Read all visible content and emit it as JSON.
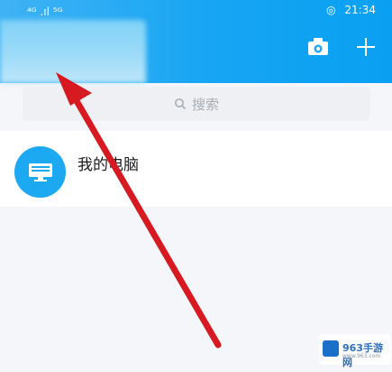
{
  "statusbar": {
    "signal": "⁴ᴳ .ıl ⁵ᴳ",
    "time": "21:34"
  },
  "header": {
    "camera_icon": "camera-icon",
    "add_icon": "plus-icon"
  },
  "search": {
    "placeholder": "搜索"
  },
  "list": {
    "items": [
      {
        "label": "我的电脑",
        "icon": "computer-icon"
      }
    ]
  },
  "watermark": {
    "brand": "963手游网",
    "sub": "www.963.com"
  },
  "colors": {
    "header": "#16a5f3",
    "arrow": "#d71a21",
    "accent": "#1da8f2"
  }
}
